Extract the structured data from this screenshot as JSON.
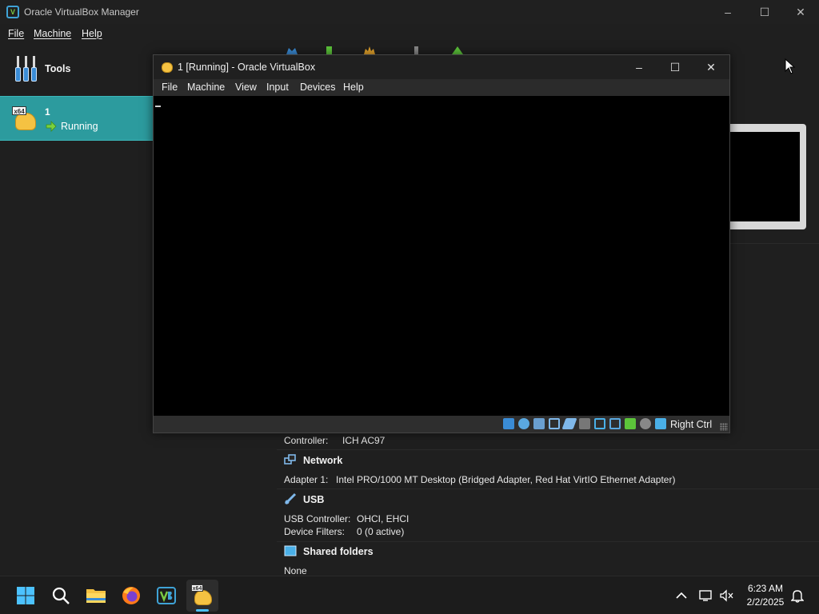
{
  "manager": {
    "title": "Oracle VirtualBox Manager",
    "menu": [
      "File",
      "Machine",
      "Help"
    ],
    "tools_label": "Tools",
    "vm": {
      "name": "1",
      "state": "Running",
      "os_tag": "x64"
    }
  },
  "details": {
    "audio_controller_label": "Controller:",
    "audio_controller_value": "ICH AC97",
    "network_header": "Network",
    "adapter_label": "Adapter 1:",
    "adapter_value": "Intel PRO/1000 MT Desktop (Bridged Adapter, Red Hat VirtIO Ethernet Adapter)",
    "usb_header": "USB",
    "usb_controller_label": "USB Controller:",
    "usb_controller_value": "OHCI, EHCI",
    "device_filters_label": "Device Filters:",
    "device_filters_value": "0 (0 active)",
    "shared_header": "Shared folders",
    "shared_value": "None"
  },
  "vm_window": {
    "title": "1 [Running] - Oracle VirtualBox",
    "menu": [
      "File",
      "Machine",
      "View",
      "Input",
      "Devices",
      "Help"
    ],
    "host_key": "Right Ctrl",
    "status_icons": [
      "hard-disk-icon",
      "optical-drive-icon",
      "audio-icon",
      "network-icon",
      "usb-icon",
      "shared-folders-icon",
      "display-icon",
      "recording-icon",
      "cpu-icon",
      "mouse-integration-icon",
      "keyboard-icon"
    ]
  },
  "taskbar": {
    "time": "6:23 AM",
    "date": "2/2/2025",
    "apps": [
      "start-icon",
      "search-icon",
      "file-explorer-icon",
      "firefox-icon",
      "virtualbox-icon",
      "vm-running-icon"
    ]
  },
  "colors": {
    "selection": "#2c9b9e",
    "accent": "#4cc2ff",
    "background": "#1f1f1f"
  }
}
